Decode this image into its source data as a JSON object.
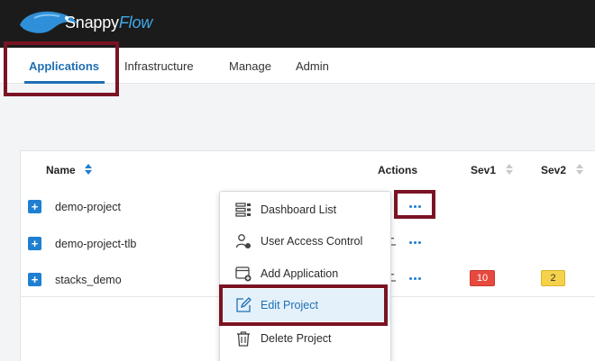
{
  "brand": {
    "name_part1": "Snappy",
    "name_part2": "Flow"
  },
  "nav": [
    {
      "label": "Applications",
      "active": true
    },
    {
      "label": "Infrastructure"
    },
    {
      "label": "Manage"
    },
    {
      "label": "Admin"
    }
  ],
  "table": {
    "columns": {
      "name": "Name",
      "actions": "Actions",
      "sev1": "Sev1",
      "sev2": "Sev2"
    },
    "rows": [
      {
        "name": "demo-project"
      },
      {
        "name": "demo-project-tlb"
      },
      {
        "name": "stacks_demo",
        "sev1": "10",
        "sev2": "2"
      }
    ]
  },
  "context_menu": [
    {
      "label": "Dashboard List",
      "icon": "dashboard-list-icon"
    },
    {
      "label": "User Access Control",
      "icon": "user-access-icon"
    },
    {
      "label": "Add Application",
      "icon": "add-application-icon"
    },
    {
      "label": "Edit Project",
      "icon": "edit-icon",
      "highlighted": true
    },
    {
      "label": "Delete Project",
      "icon": "trash-icon"
    }
  ],
  "colors": {
    "accent": "#1f6fb2",
    "topbar": "#1b1b1b",
    "sev1": "#e8493f",
    "sev2": "#f6d24b",
    "annotation": "#7a1323"
  }
}
